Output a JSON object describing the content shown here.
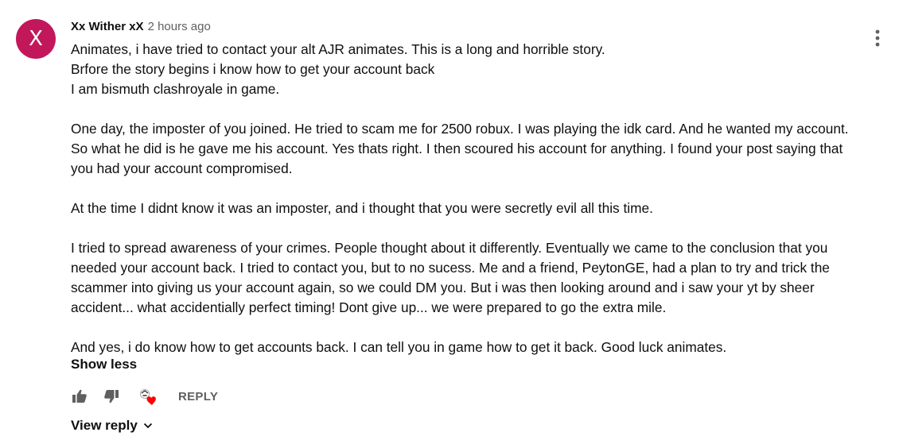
{
  "comment": {
    "avatar_letter": "X",
    "avatar_color": "#c2185b",
    "author": "Xx Wither xX",
    "timestamp": "2 hours ago",
    "paragraphs": [
      {
        "lines": [
          "Animates, i have tried to contact your alt AJR animates. This is a long and horrible story.",
          "Brfore the story begins i know how to get your account back",
          "I am bismuth clashroyale in game."
        ]
      },
      {
        "text": "One day, the imposter of you joined. He tried to scam me for 2500 robux. I was playing the idk card. And he wanted my account. So what he did is he gave me his account. Yes thats right. I then scoured his account for anything. I found your post saying that you had your account compromised."
      },
      {
        "text": "At the time I didnt know it was an imposter, and i thought that you were secretly evil all this time."
      },
      {
        "text": "I tried to spread awareness of your crimes. People thought about it differently. Eventually we came to the conclusion that you needed your account back. I tried to contact you, but to no sucess. Me and a friend, PeytonGE, had a plan to try and trick the scammer into giving us your account again, so we could DM you. But i was then looking around and i saw your yt by sheer accident... what accidentially perfect timing! Dont give up... we were prepared to go the extra mile."
      },
      {
        "text": "And yes, i do know how to get accounts back. I can tell you in game how to get it back. Good luck animates."
      }
    ],
    "show_less_label": "Show less",
    "reply_label": "REPLY",
    "view_reply_label": "View reply",
    "icons": {
      "menu": "more-vert-icon",
      "like": "thumb-up-icon",
      "dislike": "thumb-down-icon",
      "creator_heart": "creator-heart-icon",
      "chevron": "chevron-down-icon"
    },
    "heart_color": "#ff0000",
    "text_color": "#0f0f0f",
    "secondary_text_color": "#606060"
  }
}
